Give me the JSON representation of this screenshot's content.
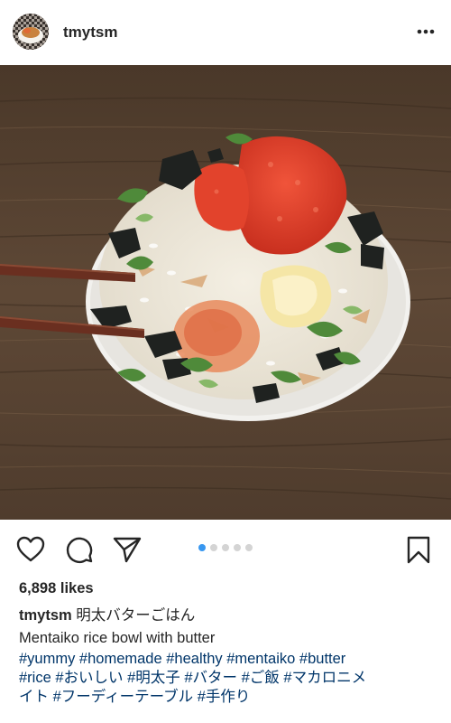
{
  "post": {
    "username": "tmytsm",
    "more_icon": "more-horizontal-icon",
    "likes": "6,898 likes",
    "caption_title": "明太バターごはん",
    "caption_line2": "Mentaiko rice bowl with butter",
    "hashtags_line1": "#yummy #homemade #healthy #mentaiko #butter",
    "hashtags_line2": "#rice #おいしい #明太子 #バター #ご飯 #マカロニメ",
    "hashtags_line3": "イト #フーディーテーブル #手作り",
    "carousel": {
      "count": 5,
      "active_index": 0
    },
    "icons": [
      "heart-icon",
      "comment-icon",
      "share-icon",
      "bookmark-icon"
    ]
  },
  "colors": {
    "hashtag": "#003569",
    "text": "#262626",
    "carousel_active": "#3897f0",
    "carousel_inactive": "#d4d4d4"
  }
}
